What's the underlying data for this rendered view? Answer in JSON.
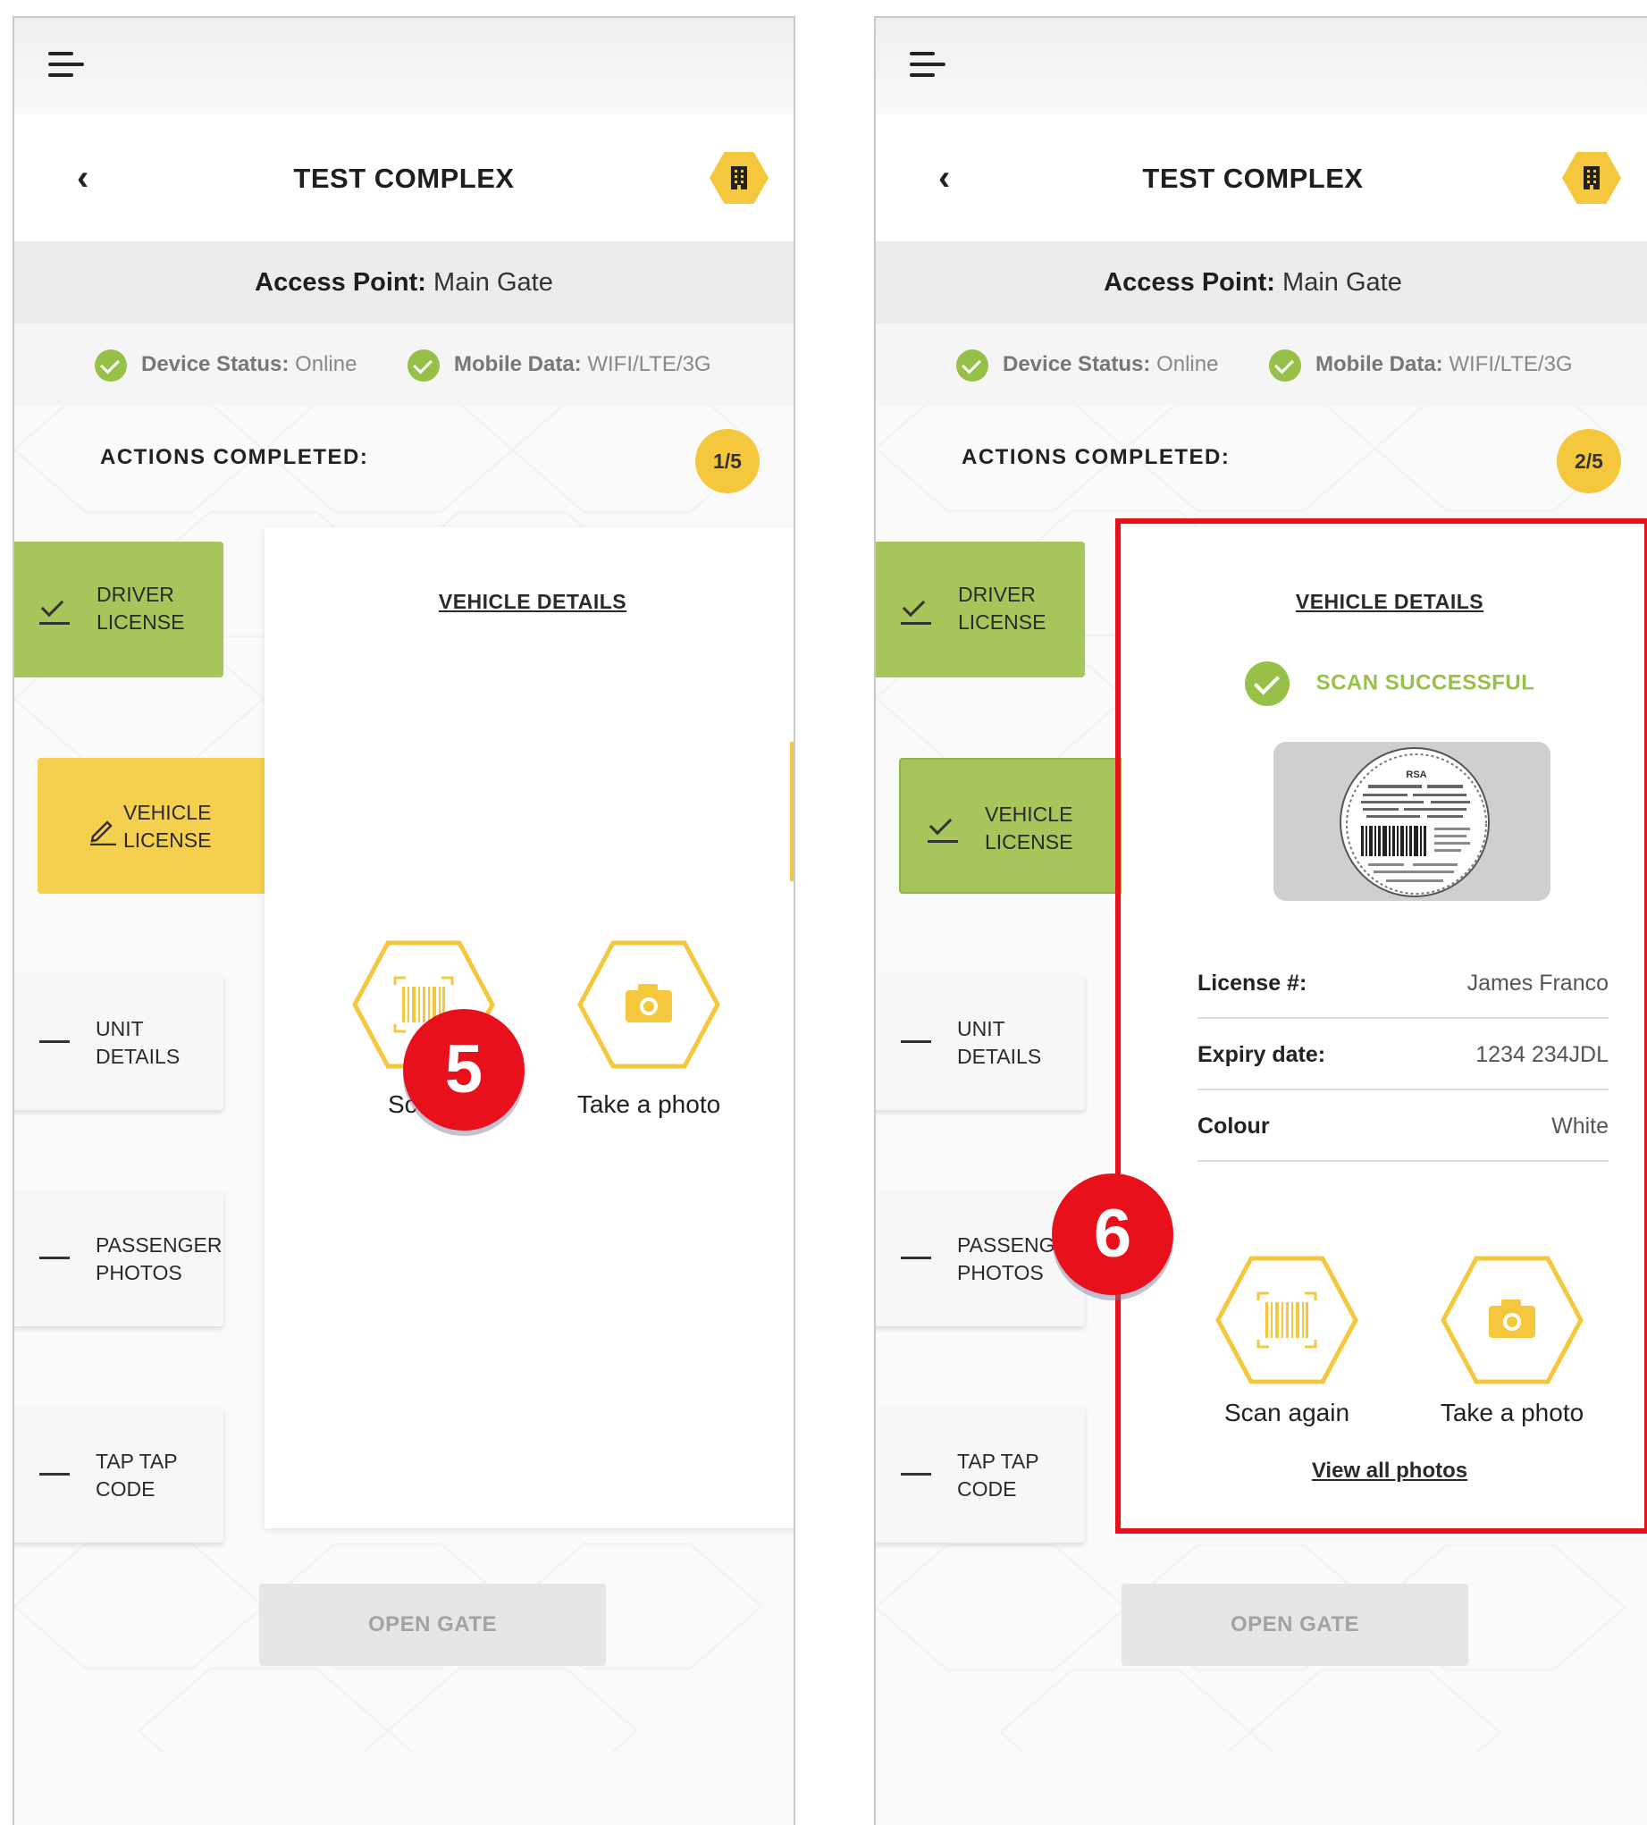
{
  "screens": [
    {
      "title": "TEST COMPLEX",
      "access_label": "Access Point:",
      "access_value": "Main Gate",
      "device_status_label": "Device Status:",
      "device_status_value": "Online",
      "mobile_data_label": "Mobile Data:",
      "mobile_data_value": "WIFI/LTE/3G",
      "actions_label": "ACTIONS COMPLETED:",
      "actions_count": "1/5",
      "card_title": "VEHICLE DETAILS",
      "scan_label": "Sc",
      "photo_label": "Take a photo",
      "open_gate": "OPEN GATE",
      "marker": "5"
    },
    {
      "title": "TEST COMPLEX",
      "access_label": "Access Point:",
      "access_value": "Main Gate",
      "device_status_label": "Device Status:",
      "device_status_value": "Online",
      "mobile_data_label": "Mobile Data:",
      "mobile_data_value": "WIFI/LTE/3G",
      "actions_label": "ACTIONS COMPLETED:",
      "actions_count": "2/5",
      "card_title": "VEHICLE DETAILS",
      "scan_success": "SCAN SUCCESSFUL",
      "details": [
        {
          "key": "License #:",
          "value": "James Franco"
        },
        {
          "key": "Expiry date:",
          "value": "1234 234JDL"
        },
        {
          "key": "Colour",
          "value": "White"
        }
      ],
      "scan_again": "Scan again",
      "photo_label": "Take a photo",
      "view_all": "View all photos",
      "open_gate": "OPEN GATE",
      "marker": "6"
    }
  ],
  "side_items": {
    "driver_license_l1": "DRIVER",
    "driver_license_l2": "LICENSE",
    "vehicle_license_l1": "VEHICLE",
    "vehicle_license_l2": "LICENSE",
    "unit_details_l1": "UNIT",
    "unit_details_l2": "DETAILS",
    "passenger_photos_l1": "PASSENGER",
    "passenger_photos_l1_clipped": "PASSENGI",
    "passenger_photos_l2": "PHOTOS",
    "tap_tap_code_l1": "TAP TAP",
    "tap_tap_code_l2": "CODE"
  },
  "license_disc_text": "RSA",
  "colors": {
    "accent_yellow": "#f5c73c",
    "success_green": "#97c048",
    "marker_red": "#e8111b"
  },
  "icons": [
    "menu-icon",
    "back-arrow-icon",
    "building-icon",
    "check-circle-icon",
    "barcode-scan-icon",
    "camera-icon",
    "pencil-icon",
    "checkmark-icon",
    "dash-icon"
  ]
}
